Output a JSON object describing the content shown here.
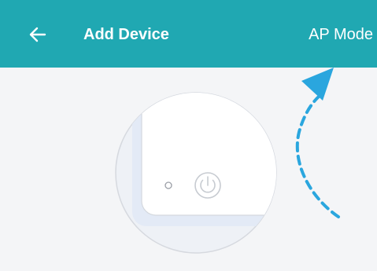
{
  "header": {
    "back_icon": "arrow-left-icon",
    "title": "Add Device",
    "mode_label": "AP Mode"
  },
  "illustration": {
    "device_icon": "device-power-button-icon",
    "indicator_icon": "status-led-icon",
    "pointer_icon": "dashed-curved-arrow-icon"
  },
  "colors": {
    "header_bg": "#20a8b2",
    "header_text": "#ffffff",
    "page_bg": "#f4f5f7",
    "accent_arrow": "#2aa6de"
  }
}
